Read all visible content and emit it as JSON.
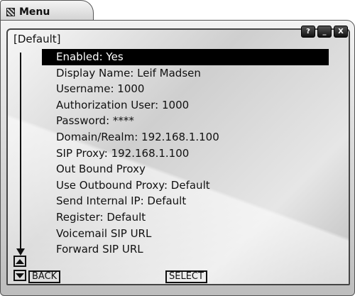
{
  "window": {
    "title": "Menu",
    "controls": [
      {
        "name": "help-button",
        "label": "?"
      },
      {
        "name": "minimize-button",
        "label": "_"
      },
      {
        "name": "close-button",
        "label": "X"
      }
    ]
  },
  "screen": {
    "section_label": "[Default]",
    "selected_index": 0,
    "items": [
      "Enabled: Yes",
      "Display Name: Leif Madsen",
      "Username: 1000",
      "Authorization User: 1000",
      "Password: ****",
      "Domain/Realm: 192.168.1.100",
      "SIP Proxy: 192.168.1.100",
      "Out Bound Proxy",
      "Use Outbound Proxy: Default",
      "Send Internal IP: Default",
      "Register: Default",
      "Voicemail SIP URL",
      "Forward SIP URL"
    ]
  },
  "softkeys": {
    "back": "BACK",
    "select": "SELECT"
  },
  "icons": {
    "app": "app-icon",
    "scroll_up": "triangle-up-icon",
    "scroll_down": "triangle-down-icon"
  }
}
